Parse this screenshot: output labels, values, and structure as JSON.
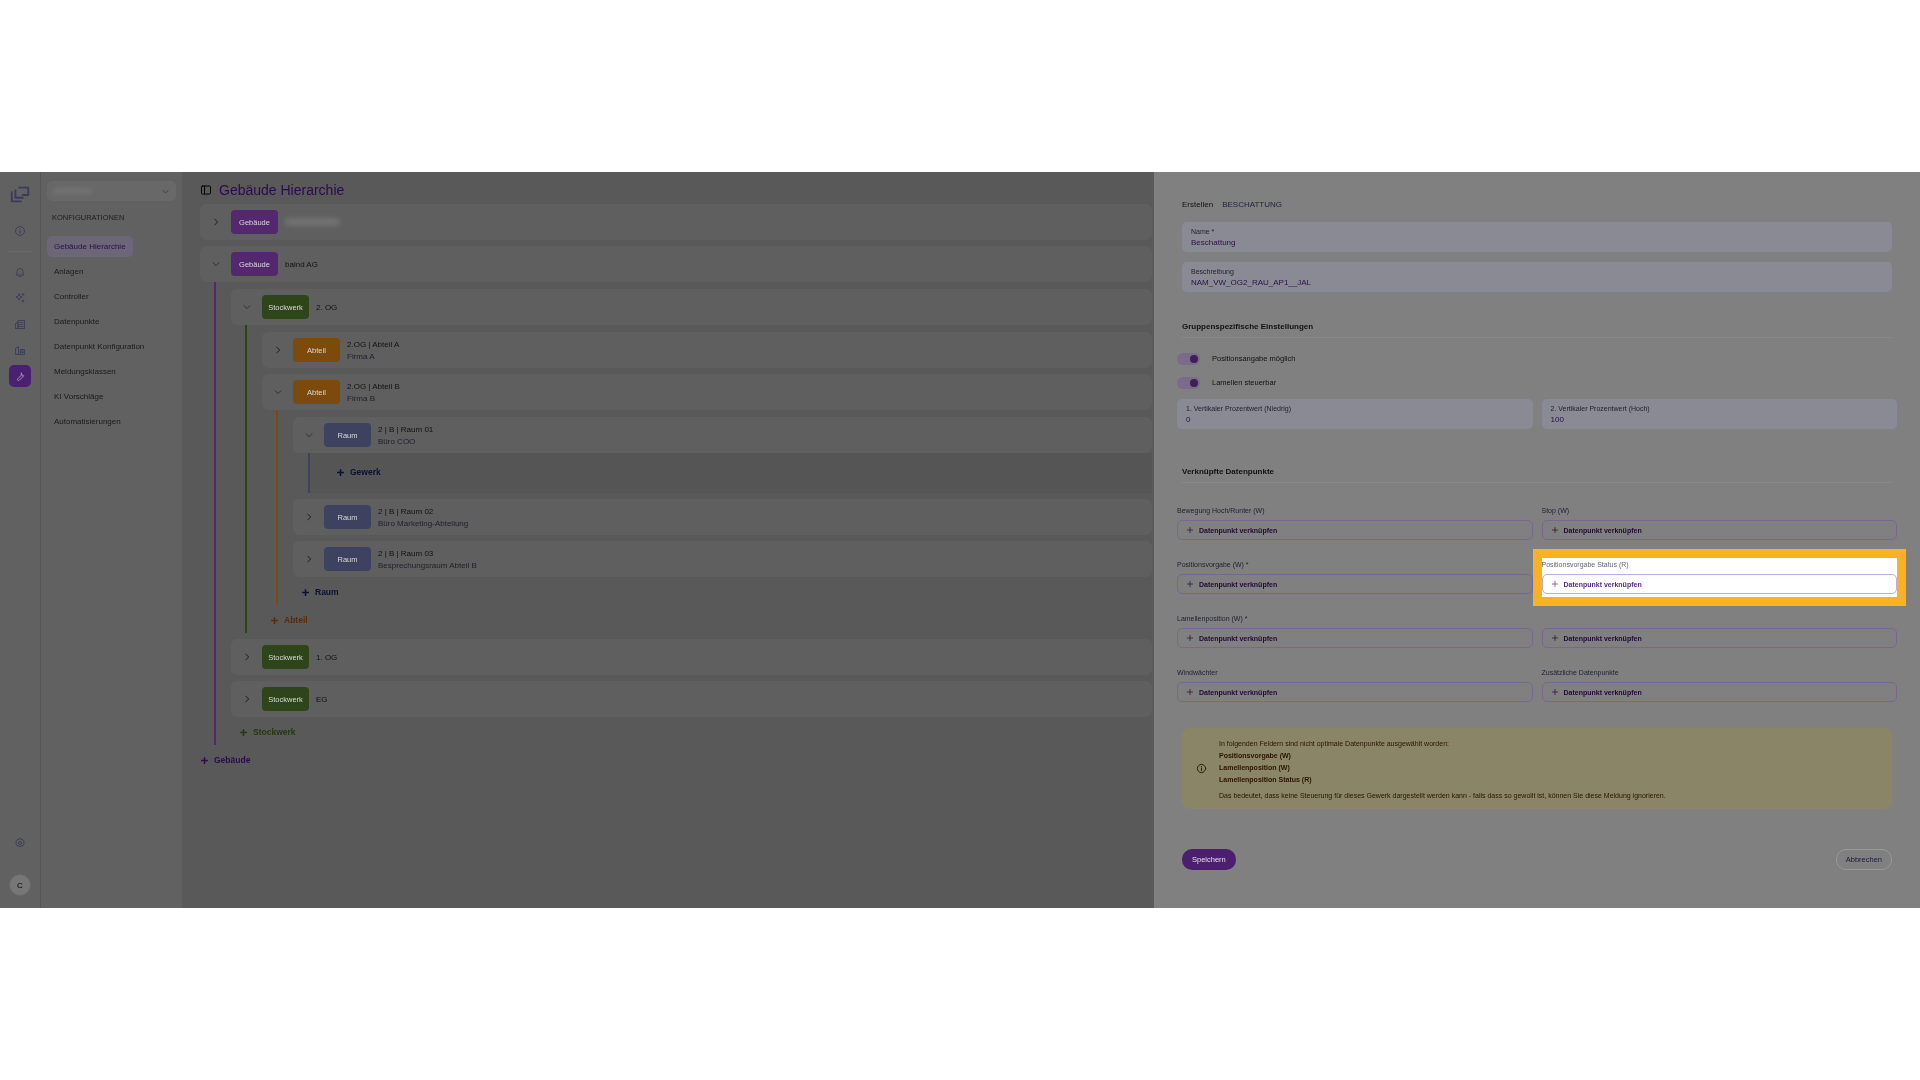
{
  "rail": {
    "items": [
      {
        "selected": false
      },
      {
        "selected": false
      },
      {
        "selected": false
      },
      {
        "selected": false
      },
      {
        "selected": false
      },
      {
        "selected": true
      }
    ],
    "bottom_items": [
      {
        "selected": false
      }
    ],
    "avatar": "C"
  },
  "sidebar": {
    "section": "KONFIGURATIONEN",
    "items": [
      {
        "label": "Gebäude Hierarchie",
        "selected": true
      },
      {
        "label": "Anlagen",
        "selected": false
      },
      {
        "label": "Controller",
        "selected": false
      },
      {
        "label": "Datenpunkte",
        "selected": false
      },
      {
        "label": "Datenpunkt Konfiguration",
        "selected": false
      },
      {
        "label": "Meldungsklassen",
        "selected": false
      },
      {
        "label": "KI Vorschläge",
        "selected": false
      },
      {
        "label": "Automatisierungen",
        "selected": false
      }
    ]
  },
  "hierarchy": {
    "title": "Gebäude Hierarchie",
    "nodes": [
      {
        "type": "Gebäude",
        "color": "#53286e",
        "redacted": true,
        "expanded": false
      },
      {
        "type": "Gebäude",
        "color": "#53286e",
        "title": "baind AG",
        "expanded": true,
        "add": {
          "label": "Stockwerk",
          "color": "#233a0c"
        },
        "children": [
          {
            "type": "Stockwerk",
            "color": "#2e4519",
            "title": "2. OG",
            "expanded": true,
            "add": {
              "label": "Abteil",
              "color": "#5a2c00"
            },
            "children": [
              {
                "type": "Abteil",
                "color": "#7c4a0c",
                "title": "2.OG | Abteil A",
                "subtitle": "Firma A",
                "expanded": false
              },
              {
                "type": "Abteil",
                "color": "#7c4a0c",
                "title": "2.OG | Abteil B",
                "subtitle": "Firma B",
                "expanded": true,
                "add": {
                  "label": "Raum",
                  "color": "#0a0f35"
                },
                "children": [
                  {
                    "type": "Raum",
                    "color": "#3d4260",
                    "title": "2 | B | Raum 01",
                    "subtitle": "Büro COO",
                    "expanded": true,
                    "add": {
                      "label": "Gewerk",
                      "color": "#0a0f35"
                    }
                  },
                  {
                    "type": "Raum",
                    "color": "#3d4260",
                    "title": "2 | B | Raum 02",
                    "subtitle": "Büro Marketing-Abteilung",
                    "expanded": false
                  },
                  {
                    "type": "Raum",
                    "color": "#3d4260",
                    "title": "2 | B | Raum 03",
                    "subtitle": "Besprechungsraum Abteil B",
                    "expanded": false
                  }
                ]
              }
            ]
          },
          {
            "type": "Stockwerk",
            "color": "#2e4519",
            "title": "1. OG",
            "expanded": false
          },
          {
            "type": "Stockwerk",
            "color": "#2e4519",
            "title": "EG",
            "expanded": false
          }
        ]
      }
    ],
    "add": {
      "label": "Gebäude",
      "color": "#2c0a50"
    }
  },
  "form": {
    "breadcrumb": [
      "Erstellen",
      "BESCHATTUNG"
    ],
    "fields": [
      {
        "label": "Name *",
        "value": "Beschattung"
      },
      {
        "label": "Beschreibung",
        "value": "NAM_VW_OG2_RAU_AP1__JAL"
      }
    ],
    "settings": {
      "title": "Gruppenspezifische Einstellungen",
      "toggles": [
        {
          "label": "Positionsangabe möglich",
          "on": true
        },
        {
          "label": "Lamellen steuerbar",
          "on": true
        }
      ],
      "inputs": [
        {
          "label": "1. Vertikaler Prozentwert (Niedrig)",
          "value": "0"
        },
        {
          "label": "2. Vertikaler Prozentwert (Hoch)",
          "value": "100"
        }
      ]
    },
    "datapoints": {
      "title": "Verknüpfte Datenpunkte",
      "slots": [
        {
          "label": "Bewegung Hoch/Runter (W)",
          "button": "Datenpunkt verknüpfen",
          "highlighted": false
        },
        {
          "label": "Stop (W)",
          "button": "Datenpunkt verknüpfen",
          "highlighted": false
        },
        {
          "label": "Positionsvorgabe (W) *",
          "button": "Datenpunkt verknüpfen",
          "highlighted": false
        },
        {
          "label": "Positionsvorgabe Status (R)",
          "button": "Datenpunkt verknüpfen",
          "highlighted": true
        },
        {
          "label": "Lamellenposition (W) *",
          "button": "Datenpunkt verknüpfen",
          "highlighted": false
        },
        {
          "button": "Datenpunkt verknüpfen",
          "highlighted": false
        },
        {
          "label": "Windwächter",
          "button": "Datenpunkt verknüpfen",
          "highlighted": false
        },
        {
          "label": "Zusätzliche Datenpunkte",
          "button": "Datenpunkt verknüpfen",
          "highlighted": false
        }
      ]
    },
    "warning": {
      "intro": "In folgenden Feldern sind nicht optimale Datenpunkte ausgewählt worden:",
      "items": [
        "Positionsvorgabe (W)",
        "Lamellenposition (W)",
        "Lamellenposition Status (R)"
      ],
      "note": "Das bedeutet, dass keine Steuerung für dieses Gewerk dargestellt werden kann - falls dass so gewollt ist, können Sie diese Meldung ignorieren."
    },
    "actions": {
      "save": "Speichern",
      "cancel": "Abbrechen"
    }
  }
}
